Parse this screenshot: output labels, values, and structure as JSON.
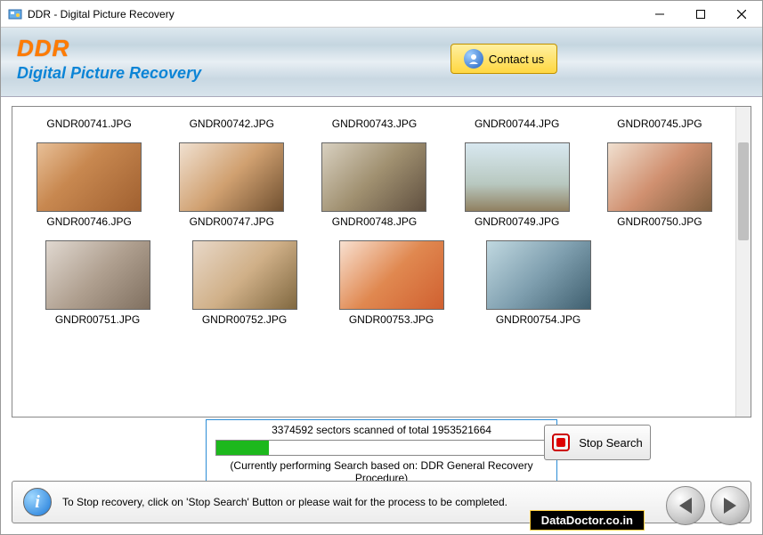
{
  "window": {
    "title": "DDR - Digital Picture Recovery"
  },
  "header": {
    "brand": "DDR",
    "subtitle": "Digital Picture Recovery",
    "contact_label": "Contact us"
  },
  "gallery": {
    "row1": [
      {
        "name": "GNDR00741.JPG"
      },
      {
        "name": "GNDR00742.JPG"
      },
      {
        "name": "GNDR00743.JPG"
      },
      {
        "name": "GNDR00744.JPG"
      },
      {
        "name": "GNDR00745.JPG"
      }
    ],
    "row2": [
      {
        "name": "GNDR00746.JPG"
      },
      {
        "name": "GNDR00747.JPG"
      },
      {
        "name": "GNDR00748.JPG"
      },
      {
        "name": "GNDR00749.JPG"
      },
      {
        "name": "GNDR00750.JPG"
      }
    ],
    "row3": [
      {
        "name": "GNDR00751.JPG"
      },
      {
        "name": "GNDR00752.JPG"
      },
      {
        "name": "GNDR00753.JPG"
      },
      {
        "name": "GNDR00754.JPG"
      }
    ]
  },
  "progress": {
    "scanned_text": "3374592 sectors scanned of total 1953521664",
    "note": "(Currently performing Search based on:  DDR General Recovery Procedure)",
    "stop_label": "Stop Search"
  },
  "footer": {
    "info_text": "To Stop recovery, click on 'Stop Search' Button or please wait for the process to be completed."
  },
  "watermark": "DataDoctor.co.in"
}
